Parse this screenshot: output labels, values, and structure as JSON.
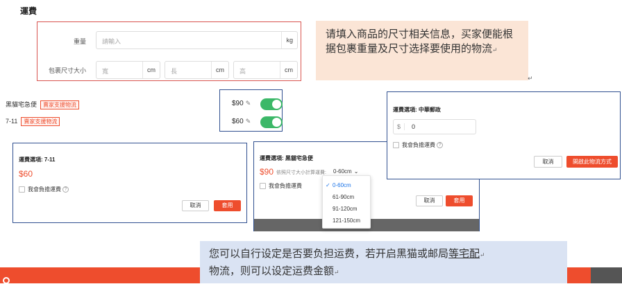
{
  "section_title": "運費",
  "form": {
    "weight_label": "重量",
    "weight_placeholder": "請輸入",
    "weight_unit": "kg",
    "size_label": "包裹尺寸大小",
    "width_placeholder": "寬",
    "length_placeholder": "長",
    "height_placeholder": "高",
    "size_unit": "cm"
  },
  "notes": {
    "top": "请填入商品的尺寸相关信息，买家便能根据包裹重量及尺寸选择要使用的物流",
    "bottom_line1": "您可以自行设定是否要负担运费，若开启黑猫或邮局",
    "bottom_underlined": "等宅配",
    "bottom_line2": "物流，则可以设定运费金额",
    "mark": "↵"
  },
  "shipping": {
    "items": [
      {
        "name": "黑貓宅急便",
        "tag": "賣家支援物流",
        "price": "$90"
      },
      {
        "name": "7-11",
        "tag": "賣家支援物流",
        "price": "$60"
      }
    ],
    "pencil": "✎",
    "toggle_color": "#3cb868"
  },
  "dialog_711": {
    "title": "運費選項: 7-11",
    "price": "$60",
    "checkbox_label": "我會負擔運費",
    "cancel": "取消",
    "confirm": "套用"
  },
  "dialog_cat": {
    "title": "運費選項: 黑貓宅急便",
    "price": "$90",
    "size_label": "依照尺寸大小計算運費:",
    "size_selected": "0-60cm",
    "checkbox_label": "我會負擔運費",
    "cancel": "取消",
    "confirm": "套用",
    "options": [
      "0-60cm",
      "61-90cm",
      "91-120cm",
      "121-150cm"
    ]
  },
  "dialog_post": {
    "title": "運費選項: 中華郵政",
    "currency": "$",
    "value": "0",
    "checkbox_label": "我會負擔運費",
    "cancel": "取消",
    "confirm": "開啟此物流方式"
  },
  "accent_color": "#ee4d2d"
}
